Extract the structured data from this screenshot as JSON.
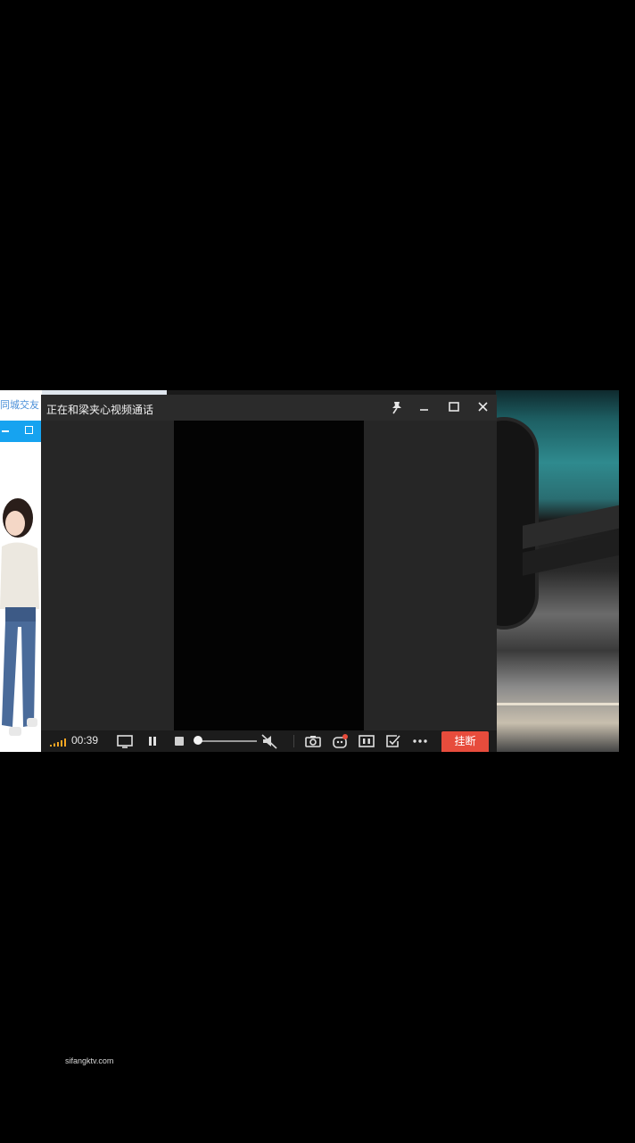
{
  "background_window": {
    "title_partial": "同城交友"
  },
  "call_window": {
    "title": "正在和梁夹心视频通话",
    "pin_icon": "pin-icon",
    "minimize_icon": "minimize-icon",
    "maximize_icon": "maximize-icon",
    "close_icon": "close-icon"
  },
  "controls": {
    "signal_icon": "signal-strength-icon",
    "elapsed_time": "00:39",
    "screen_share_icon": "screen-share-icon",
    "pause_icon": "pause-icon",
    "stop_icon": "stop-icon",
    "volume_level": 0.0,
    "mute_icon": "speaker-muted-icon",
    "camera_icon": "camera-icon",
    "face_effect_icon": "face-effect-icon",
    "layout_icon": "layout-icon",
    "edit_icon": "edit-check-icon",
    "more_icon": "more-icon",
    "hangup_label": "挂断",
    "hangup_color": "#e74c3c"
  },
  "watermark": "sifangktv.com"
}
